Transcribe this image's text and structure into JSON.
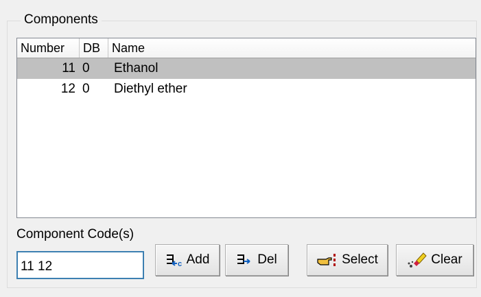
{
  "group": {
    "title": "Components"
  },
  "list": {
    "columns": [
      "Number",
      "DB",
      "Name"
    ],
    "rows": [
      {
        "number": "11",
        "db": "0",
        "name": "Ethanol",
        "selected": true
      },
      {
        "number": "12",
        "db": "0",
        "name": "Diethyl ether",
        "selected": false
      }
    ]
  },
  "code": {
    "label": "Component Code(s)",
    "value": "11 12"
  },
  "buttons": {
    "add": "Add",
    "del": "Del",
    "select": "Select",
    "clear": "Clear"
  },
  "icons": {
    "add": "add-component-icon",
    "del": "delete-component-icon",
    "select": "pointing-hand-icon",
    "clear": "eraser-icon"
  }
}
